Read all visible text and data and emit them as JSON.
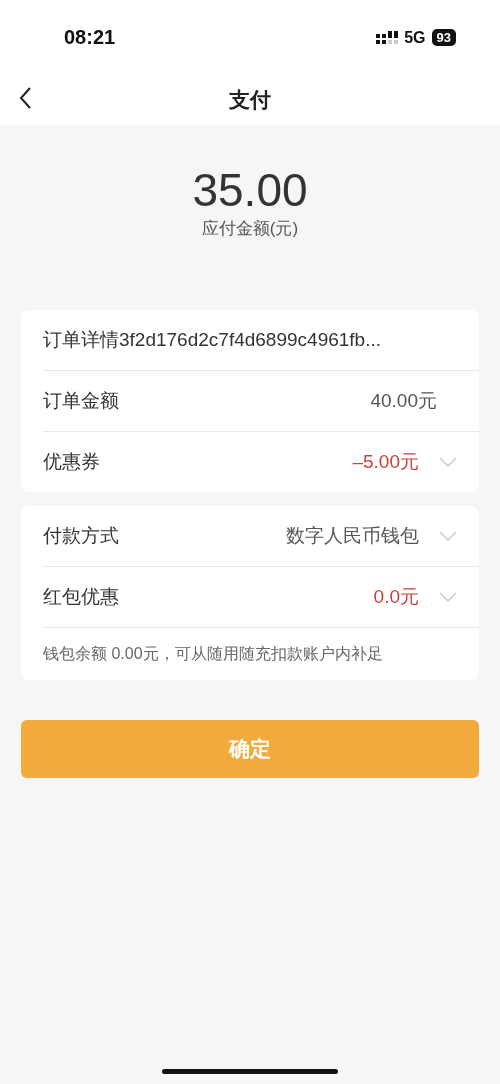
{
  "status_bar": {
    "time": "08:21",
    "network": "5G",
    "battery": "93"
  },
  "nav": {
    "title": "支付"
  },
  "amount": {
    "value": "35.00",
    "label": "应付金额(元)"
  },
  "sections": [
    {
      "rows": [
        {
          "kind": "title",
          "label": "订单详情3f2d176d2c7f4d6899c4961fb..."
        },
        {
          "kind": "value",
          "label": "订单金额",
          "value": "40.00元",
          "highlighted": false,
          "dropdown": false
        },
        {
          "kind": "value",
          "label": "优惠券",
          "value": "–5.00元",
          "highlighted": true,
          "dropdown": true
        }
      ]
    },
    {
      "rows": [
        {
          "kind": "value",
          "label": "付款方式",
          "value": "数字人民币钱包",
          "highlighted": false,
          "dropdown": true
        },
        {
          "kind": "value",
          "label": "红包优惠",
          "value": "0.0元",
          "highlighted": true,
          "dropdown": true
        },
        {
          "kind": "note",
          "label": "钱包余额  0.00元，可从随用随充扣款账户内补足"
        }
      ]
    }
  ],
  "confirm_button": "确定"
}
